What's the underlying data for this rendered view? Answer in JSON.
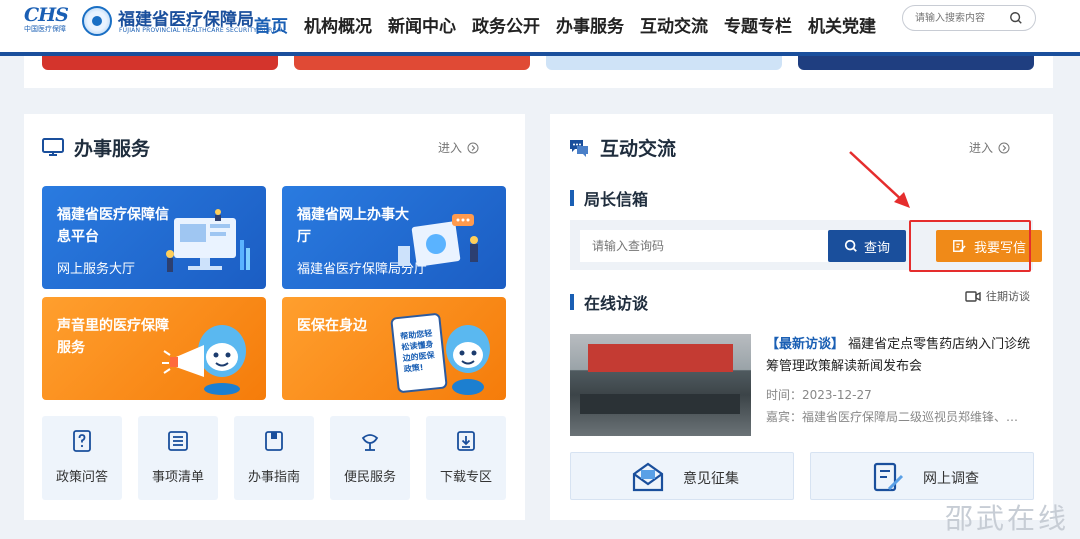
{
  "header": {
    "logo_text": "CHS",
    "logo_sub": "中国医疗保障",
    "org_name": "福建省医疗保障局",
    "org_en": "FUJIAN PROVINCIAL HEALTHCARE SECURITY BUREAU",
    "nav": [
      "首页",
      "机构概况",
      "新闻中心",
      "政务公开",
      "办事服务",
      "互动交流",
      "专题专栏",
      "机关党建"
    ],
    "search_placeholder": "请输入搜索内容"
  },
  "service": {
    "title": "办事服务",
    "enter": "进入",
    "tiles": [
      {
        "title": "福建省医疗保障信息平台",
        "sub": "网上服务大厅"
      },
      {
        "title": "福建省网上办事大厅",
        "sub": "福建省医疗保障局分厅"
      },
      {
        "title": "声音里的医疗保障服务",
        "sub": ""
      },
      {
        "title": "医保在身边",
        "sub": "",
        "poster": "帮助您轻松读懂身边的医保政策!"
      }
    ],
    "buttons": [
      "政策问答",
      "事项清单",
      "办事指南",
      "便民服务",
      "下载专区"
    ]
  },
  "interaction": {
    "title": "互动交流",
    "enter": "进入",
    "mailbox_title": "局长信箱",
    "query_placeholder": "请输入查询码",
    "query_btn": "查询",
    "write_btn": "我要写信",
    "online_title": "在线访谈",
    "past_link": "往期访谈",
    "news_tag": "【最新访谈】",
    "news_title": "福建省定点零售药店纳入门诊统筹管理政策解读新闻发布会",
    "time": "时间：2023-12-27",
    "guest": "嘉宾：福建省医疗保障局二级巡视员郑维锋、…",
    "bottom": [
      "意见征集",
      "网上调查"
    ]
  },
  "colors": {
    "primary": "#1a4f9c",
    "orange": "#f08a18",
    "highlight": "#e52d2d"
  },
  "watermark": "邵武在线"
}
